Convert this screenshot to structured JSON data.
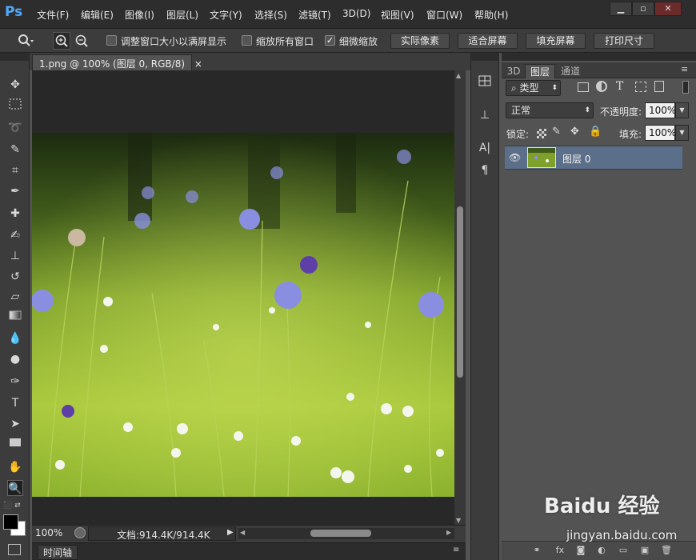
{
  "app": {
    "logo": "Ps"
  },
  "menu": [
    "文件(F)",
    "编辑(E)",
    "图像(I)",
    "图层(L)",
    "文字(Y)",
    "选择(S)",
    "滤镜(T)",
    "3D(D)",
    "视图(V)",
    "窗口(W)",
    "帮助(H)"
  ],
  "window_controls": {
    "minimize": "▁",
    "restore": "▫",
    "close": "✕"
  },
  "options": {
    "resize_windows_label": "调整窗口大小以满屏显示",
    "resize_windows_checked": false,
    "zoom_all_label": "缩放所有窗口",
    "zoom_all_checked": false,
    "scrubby_zoom_label": "细微缩放",
    "scrubby_zoom_checked": true,
    "actual_pixels": "实际像素",
    "fit_screen": "适合屏幕",
    "fill_screen": "填充屏幕",
    "print_size": "打印尺寸"
  },
  "document": {
    "tab_title": "1.png @ 100% (图层 0, RGB/8)",
    "tab_close": "×",
    "zoom": "100%",
    "doc_size": "文档:914.4K/914.4K",
    "timeline_label": "时间轴"
  },
  "layers_panel": {
    "tabs": [
      "3D",
      "图层",
      "通道"
    ],
    "active_tab": "图层",
    "filter_kind": "类型",
    "blend_mode": "正常",
    "opacity_label": "不透明度:",
    "opacity_value": "100%",
    "lock_label": "锁定:",
    "fill_label": "填充:",
    "fill_value": "100%",
    "layers": [
      {
        "name": "图层 0",
        "visible": true,
        "selected": true
      }
    ]
  },
  "icons": {
    "tools": [
      "move-icon",
      "marquee-icon",
      "lasso-icon",
      "quick-selection-icon",
      "crop-icon",
      "eyedropper-icon",
      "healing-brush-icon",
      "brush-icon",
      "clone-stamp-icon",
      "history-brush-icon",
      "eraser-icon",
      "gradient-icon",
      "blur-icon",
      "dodge-icon",
      "pen-icon",
      "type-icon",
      "path-selection-icon",
      "rectangle-icon",
      "hand-icon",
      "zoom-icon"
    ],
    "foreground_color": "#000000",
    "background_color": "#ffffff"
  },
  "colors": {
    "selected_layer": "#5b6f8a",
    "ps_logo": "#4fa9ff"
  },
  "watermark": {
    "brand": "Baidu 经验",
    "url": "jingyan.baidu.com"
  }
}
